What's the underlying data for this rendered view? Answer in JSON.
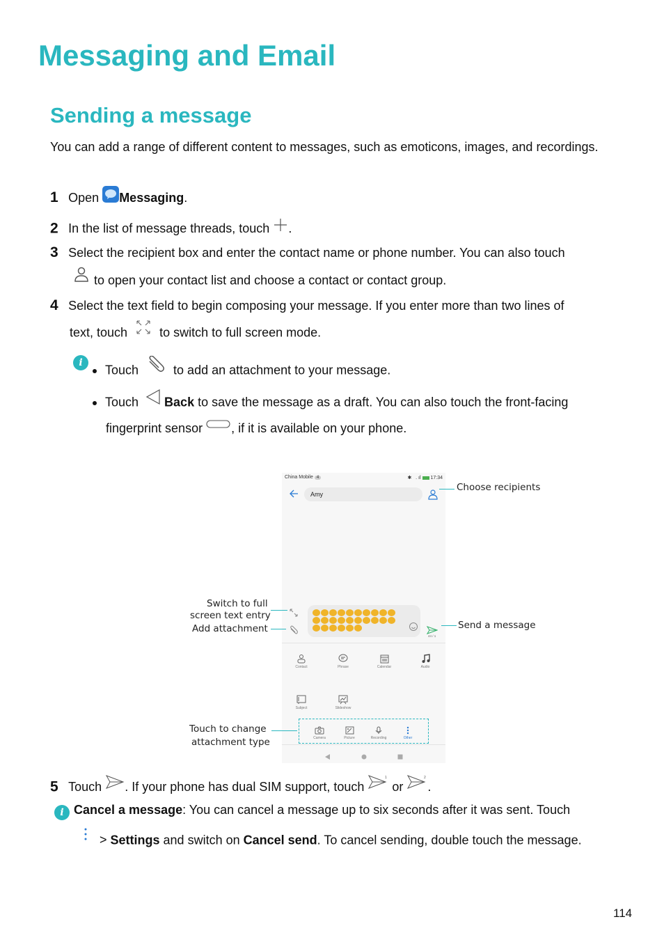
{
  "page": {
    "chapter_title": "Messaging and Email",
    "section_title": "Sending a message",
    "intro": "You can add a range of different content to messages, such as emoticons, images, and recordings.",
    "page_number": "114"
  },
  "steps": [
    {
      "num": "1",
      "pre": "Open ",
      "bold": "Messaging",
      "post": "."
    },
    {
      "num": "2",
      "text": "In the list of message threads, touch ",
      "post": "."
    },
    {
      "num": "3",
      "line1": "Select the recipient box and enter the contact name or phone number. You can also touch",
      "line2": " to open your contact list and choose a contact or contact group."
    },
    {
      "num": "4",
      "line1": "Select the text field to begin composing your message. If you enter more than two lines of",
      "line2_pre": "text, touch ",
      "line2_post": " to switch to full screen mode."
    },
    {
      "num": "5",
      "pre": "Touch ",
      "mid": ". If your phone has dual SIM support, touch ",
      "or": " or ",
      "post": "."
    }
  ],
  "tips": {
    "bullet1_pre": "Touch ",
    "bullet1_post": " to add an attachment to your message.",
    "bullet2_pre": "Touch ",
    "bullet2_bold": "Back",
    "bullet2_post": " to save the message as a draft. You can also touch the front-facing",
    "bullet2_line2_pre": "fingerprint sensor ",
    "bullet2_line2_post": ", if it is available on your phone."
  },
  "cancel_note": {
    "bold": "Cancel a message",
    "text": ": You can cancel a message up to six seconds after it was sent. Touch",
    "line2_sep": " > ",
    "settings": "Settings",
    "line2_mid": " and switch on ",
    "cancel_send": "Cancel send",
    "line2_post": ". To cancel sending, double touch the message."
  },
  "phone": {
    "carrier": "China Mobile",
    "carrier_badge": "4",
    "time": "17:34",
    "recipient": "Amy",
    "char_count": "44 / 1",
    "attachments_row1": [
      "Contact",
      "Phrase",
      "Calendar",
      "Audio"
    ],
    "attachments_row2": [
      "Subject",
      "Slideshow"
    ],
    "attachment_types": [
      "Camera",
      "Picture",
      "Recording",
      "Other"
    ]
  },
  "callouts": {
    "choose_recipients": "Choose recipients",
    "switch_full_1": "Switch to full",
    "switch_full_2": "screen text entry",
    "add_attachment": "Add attachment",
    "send_message": "Send a message",
    "change_type_1": "Touch to change",
    "change_type_2": "attachment type"
  },
  "colors": {
    "accent": "#2ab7bf",
    "send_green": "#3cb371",
    "link_blue": "#2a7bd4"
  }
}
